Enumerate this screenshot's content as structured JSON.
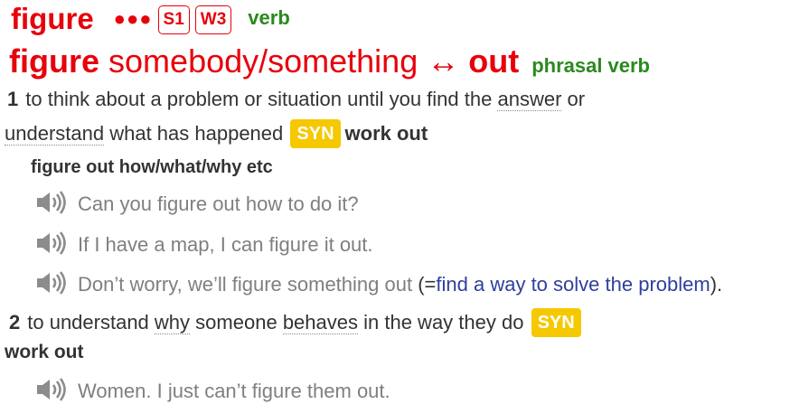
{
  "entry": {
    "headword": "figure",
    "frequency_dots": "●●●",
    "frequency_labels": [
      "S1",
      "W3"
    ],
    "pos": "verb"
  },
  "phrasal": {
    "head": "figure",
    "object": "somebody/something",
    "arrow": "↔",
    "particle": "out",
    "pos1": "phrasal",
    "pos2": "verb"
  },
  "sense1": {
    "num": "1",
    "def_line1_a": "to think about a problem or situation until you find the",
    "def_line1_link": "answer",
    "def_line1_b": "or",
    "def_line2_link": "understand",
    "def_line2_b": "what has happened",
    "syn_label": "SYN",
    "syn_word": "work out",
    "pattern": "figure out how/what/why etc",
    "examples": [
      "Can you figure out how to do it?",
      "If I have a map, I can figure it out.",
      "Don’t worry, we’ll figure something out"
    ],
    "gloss_open": "(=",
    "gloss_a": "find a way to solve",
    "gloss_b": "the problem",
    "gloss_close": ")."
  },
  "sense2": {
    "num": "2",
    "def_a": "to understand",
    "def_link1": "why",
    "def_b": "someone",
    "def_link2": "behaves",
    "def_c": "in the way they do",
    "syn_label": "SYN",
    "syn_word": "work out",
    "examples": [
      "Women. I just can’t figure them out."
    ]
  },
  "icons": {
    "speaker": "speaker-icon"
  },
  "colors": {
    "headword": "#e8000b",
    "pos": "#2a8a1d",
    "syn_bg": "#f5c800",
    "example": "#7f7f7f",
    "gloss": "#2e3f9e"
  }
}
